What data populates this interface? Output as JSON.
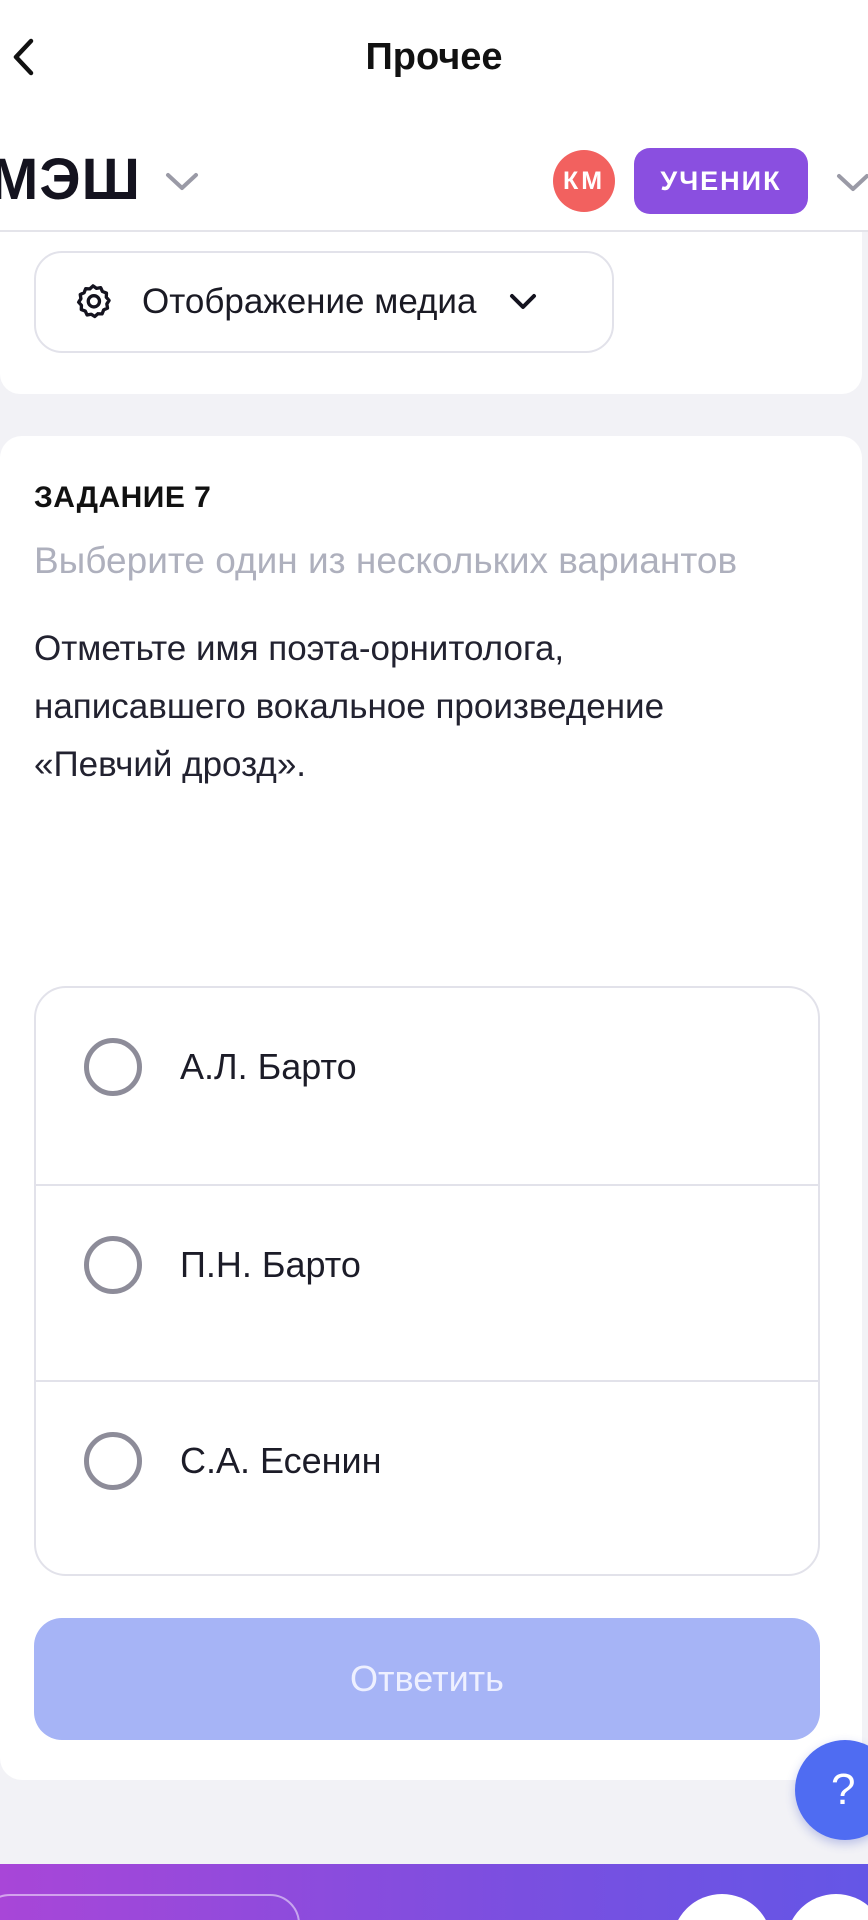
{
  "navbar": {
    "title": "Прочее",
    "back_icon": "chevron-left-icon"
  },
  "header": {
    "logo": "МЭШ",
    "logo_menu_icon": "chevron-down-icon",
    "avatar_initials": "КМ",
    "avatar_color": "#f2615f",
    "role_label": "УЧЕНИК",
    "role_color": "#8a4fe0",
    "profile_menu_icon": "chevron-down-icon"
  },
  "media": {
    "label": "Отображение медиа",
    "icon": "gear-icon",
    "dropdown_icon": "chevron-down-icon"
  },
  "task": {
    "label": "ЗАДАНИЕ 7",
    "hint": "Выберите один из нескольких вариантов",
    "question_lines": [
      "Отметьте имя поэта-орнитолога,",
      "написавшего вокальное произведение",
      "«Певчий дрозд»."
    ],
    "options": [
      {
        "label": "А.Л. Барто",
        "selected": false
      },
      {
        "label": "П.Н. Барто",
        "selected": false
      },
      {
        "label": "С.А. Есенин",
        "selected": false
      }
    ],
    "submit_label": "Ответить",
    "submit_color": "#a6b4f6"
  },
  "help": {
    "label": "?",
    "color": "#4f6cf2"
  }
}
